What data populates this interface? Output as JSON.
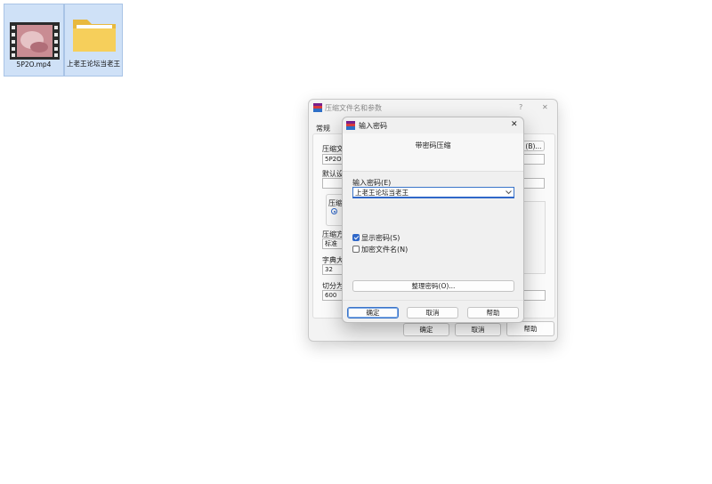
{
  "desktop": {
    "icons": [
      {
        "label": "5P2O.mp4",
        "icon": "video-file-icon"
      },
      {
        "label": "上老王论坛当老王",
        "icon": "folder-icon"
      }
    ]
  },
  "bg_dialog": {
    "title": "压缩文件名和参数",
    "help_glyph": "?",
    "close_glyph": "✕",
    "tab_general": "常规",
    "archive_name_label": "压缩文",
    "archive_name_value": "5P2O",
    "browse_button": "(B)...",
    "default_label": "默认设",
    "format_label": "压缩",
    "method_label": "压缩方",
    "method_value": "标准",
    "dict_label": "字典大",
    "dict_value": "32",
    "split_label": "切分为",
    "split_value": "600",
    "ok": "确定",
    "cancel": "取消",
    "help": "帮助"
  },
  "pw_dialog": {
    "title": "输入密码",
    "close_glyph": "✕",
    "heading": "带密码压缩",
    "enter_password_label": "输入密码(E)",
    "password_value": "上老王论坛当老王",
    "show_password_label": "显示密码(S)",
    "show_password_checked": true,
    "encrypt_names_label": "加密文件名(N)",
    "encrypt_names_checked": false,
    "organize_button": "整理密码(O)...",
    "ok": "确定",
    "cancel": "取消",
    "help": "帮助"
  },
  "colors": {
    "accent": "#2f67c8",
    "selection": "#cfe1f7"
  }
}
